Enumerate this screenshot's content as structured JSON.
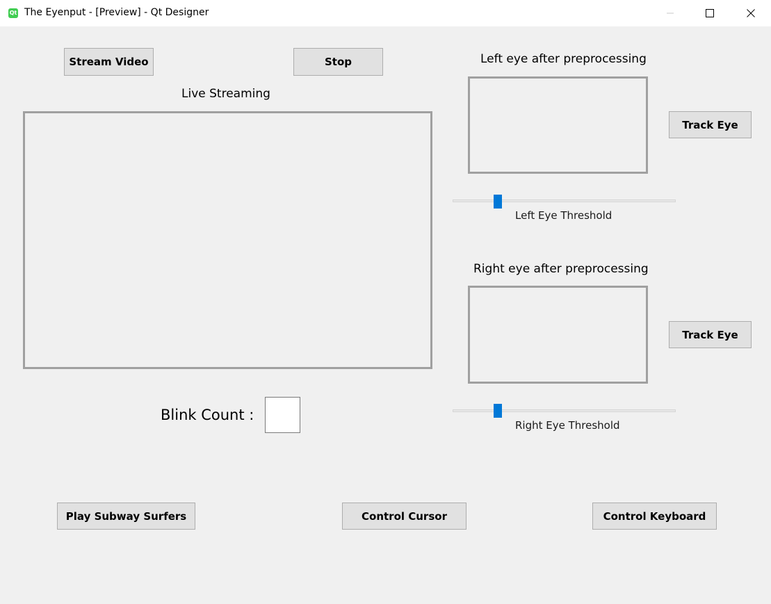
{
  "window": {
    "app_icon": "Qt",
    "title": "The Eyenput - [Preview] - Qt Designer"
  },
  "buttons": {
    "stream_video": "Stream Video",
    "stop": "Stop",
    "track_eye_left": "Track Eye",
    "track_eye_right": "Track Eye",
    "play_subway": "Play Subway Surfers",
    "control_cursor": "Control Cursor",
    "control_keyboard": "Control Keyboard"
  },
  "labels": {
    "live_streaming": "Live Streaming",
    "left_eye": "Left eye after preprocessing",
    "right_eye": "Right eye after preprocessing",
    "left_threshold": "Left Eye Threshold",
    "right_threshold": "Right Eye Threshold",
    "blink_count": "Blink Count :"
  },
  "blink_count_value": "",
  "sliders": {
    "left_threshold_level": 0.19,
    "right_threshold_level": 0.19
  },
  "colors": {
    "accent": "#0078d7",
    "window_bg": "#f0f0f0",
    "button_bg": "#e1e1e1"
  }
}
